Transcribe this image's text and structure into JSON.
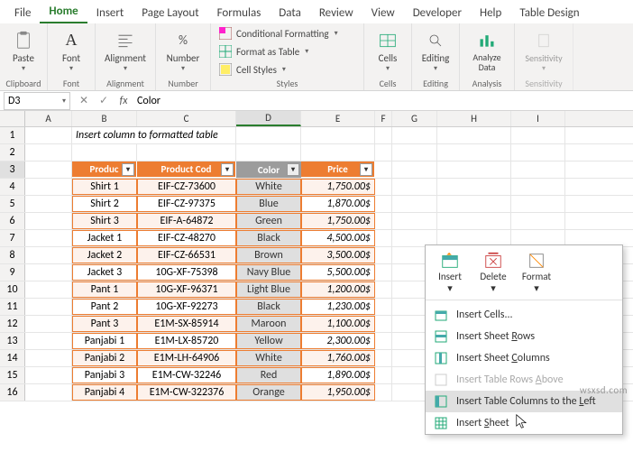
{
  "tabs": {
    "file": "File",
    "home": "Home",
    "insert": "Insert",
    "pagelayout": "Page Layout",
    "formulas": "Formulas",
    "data": "Data",
    "review": "Review",
    "view": "View",
    "developer": "Developer",
    "help": "Help",
    "tabledesign": "Table Design"
  },
  "ribbon": {
    "clipboard": {
      "paste": "Paste",
      "label": "Clipboard"
    },
    "font": {
      "label": "Font",
      "btn": "Font"
    },
    "alignment": {
      "label": "Alignment",
      "btn": "Alignment"
    },
    "number": {
      "label": "Number",
      "btn": "Number"
    },
    "styles": {
      "label": "Styles",
      "cond": "Conditional Formatting",
      "table": "Format as Table",
      "cell": "Cell Styles"
    },
    "cells": {
      "label": "Cells",
      "btn": "Cells"
    },
    "editing": {
      "label": "Editing",
      "btn": "Editing"
    },
    "analysis": {
      "label": "Analysis",
      "btn": "Analyze Data"
    },
    "sensitivity": {
      "label": "Sensitivity",
      "btn": "Sensitivity"
    }
  },
  "namebox": "D3",
  "formula": "Color",
  "cols": [
    "A",
    "B",
    "C",
    "D",
    "E",
    "F",
    "G",
    "H",
    "I"
  ],
  "rows": [
    "1",
    "2",
    "3",
    "4",
    "5",
    "6",
    "7",
    "8",
    "9",
    "10",
    "11",
    "12",
    "13",
    "14",
    "15",
    "16"
  ],
  "note": "Insert column to formatted table",
  "headers": {
    "product": "Produc",
    "code": "Product Cod",
    "color": "Color",
    "price": "Price"
  },
  "table": [
    {
      "p": "Shirt 1",
      "c": "EIF-CZ-73600",
      "col": "White",
      "pr": "1,750.00$"
    },
    {
      "p": "Shirt 2",
      "c": "EIF-CZ-97375",
      "col": "Blue",
      "pr": "1,870.00$"
    },
    {
      "p": "Shirt 3",
      "c": "EIF-A-64872",
      "col": "Green",
      "pr": "1,750.00$"
    },
    {
      "p": "Jacket 1",
      "c": "EIF-CZ-48270",
      "col": "Black",
      "pr": "4,500.00$"
    },
    {
      "p": "Jacket 2",
      "c": "EIF-CZ-66531",
      "col": "Brown",
      "pr": "3,500.00$"
    },
    {
      "p": "Jacket 3",
      "c": "10G-XF-75398",
      "col": "Navy Blue",
      "pr": "5,500.00$"
    },
    {
      "p": "Pant 1",
      "c": "10G-XF-96371",
      "col": "Light Blue",
      "pr": "1,200.00$"
    },
    {
      "p": "Pant 2",
      "c": "10G-XF-92273",
      "col": "Black",
      "pr": "1,230.00$"
    },
    {
      "p": "Pant 3",
      "c": "E1M-SX-85914",
      "col": "Maroon",
      "pr": "1,100.00$"
    },
    {
      "p": "Panjabi 1",
      "c": "E1M-LX-85720",
      "col": "Yellow",
      "pr": "2,300.00$"
    },
    {
      "p": "Panjabi 2",
      "c": "E1M-LH-64906",
      "col": "White",
      "pr": "1,760.00$"
    },
    {
      "p": "Panjabi 3",
      "c": "E1M-CW-32246",
      "col": "Red",
      "pr": "1,890.00$"
    },
    {
      "p": "Panjabi 4",
      "c": "E1M-CW-322376",
      "col": "Orange",
      "pr": "1,950.00$"
    }
  ],
  "menu": {
    "insert": "Insert",
    "delete": "Delete",
    "format": "Format",
    "cells": "Insert Cells...",
    "rows": "Insert Sheet Rows",
    "cols": "Insert Sheet Columns",
    "trowsabove": "Insert Table Rows Above",
    "tcolsleft": "Insert Table Columns to the Left",
    "sheet": "Insert Sheet"
  },
  "watermark": "wsxsd.com"
}
